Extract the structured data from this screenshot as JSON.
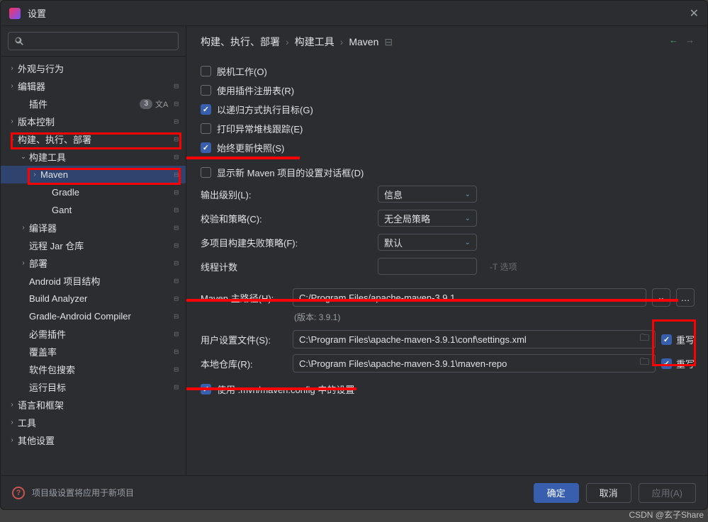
{
  "title": "设置",
  "sidebar": {
    "search_placeholder": "",
    "items": {
      "appearance": "外观与行为",
      "editor": "编辑器",
      "plugins": "插件",
      "plugins_badge": "3",
      "vcs": "版本控制",
      "build": "构建、执行、部署",
      "build_tools": "构建工具",
      "maven": "Maven",
      "gradle": "Gradle",
      "gant": "Gant",
      "compiler": "编译器",
      "remote_jar": "远程 Jar 仓库",
      "deploy": "部署",
      "android_struct": "Android 项目结构",
      "build_analyzer": "Build Analyzer",
      "gradle_android": "Gradle-Android Compiler",
      "req_plugins": "必需插件",
      "coverage": "覆盖率",
      "pkg_search": "软件包搜索",
      "run_target": "运行目标",
      "lang_frame": "语言和框架",
      "tools": "工具",
      "other": "其他设置"
    }
  },
  "breadcrumb": {
    "a": "构建、执行、部署",
    "b": "构建工具",
    "c": "Maven"
  },
  "checks": {
    "offline": "脱机工作(O)",
    "plugin_registry": "使用插件注册表(R)",
    "recursive": "以递归方式执行目标(G)",
    "print_stack": "打印异常堆栈跟踪(E)",
    "always_update": "始终更新快照(S)",
    "show_dialog": "显示新 Maven 项目的设置对话框(D)",
    "use_mvn_config": "使用 .mvn/maven.config 中的设置"
  },
  "labels": {
    "output_level": "输出级别(L):",
    "checksum": "校验和策略(C):",
    "multi_fail": "多项目构建失败策略(F):",
    "thread_count": "线程计数",
    "t_option": "-T 选项",
    "maven_home": "Maven 主路径(H):",
    "version": "(版本: 3.9.1)",
    "user_settings": "用户设置文件(S):",
    "local_repo": "本地仓库(R):",
    "override": "重写"
  },
  "values": {
    "output_level": "信息",
    "checksum": "无全局策略",
    "multi_fail": "默认",
    "thread_count": "",
    "maven_home": "C:/Program Files/apache-maven-3.9.1",
    "user_settings": "C:\\Program Files\\apache-maven-3.9.1\\conf\\settings.xml",
    "local_repo": "C:\\Program Files\\apache-maven-3.9.1\\maven-repo"
  },
  "footer": {
    "text": "项目级设置将应用于新项目",
    "ok": "确定",
    "cancel": "取消",
    "apply": "应用(A)"
  },
  "watermark": "CSDN @玄子Share"
}
